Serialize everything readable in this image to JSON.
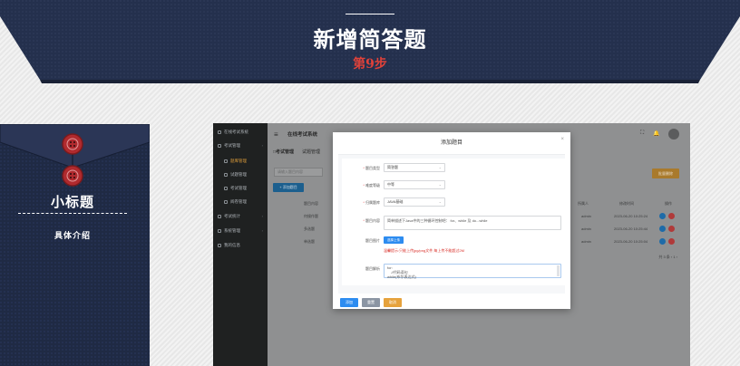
{
  "banner": {
    "title": "新增简答题",
    "step": "第9步",
    "background_color": "#232c47",
    "step_color": "#e0423a"
  },
  "envelope": {
    "title": "小标题",
    "subtitle": "具体介绍",
    "background_color": "#1f2a44",
    "button_color": "#b02a2e",
    "icons": [
      "button-icon",
      "button-icon"
    ]
  },
  "app": {
    "name": "在线考试系统",
    "sidebar": {
      "brand": "在线考试系统",
      "items": [
        {
          "label": "考试管理",
          "icon": "grid-icon",
          "chevron": "›"
        },
        {
          "label": "题库管理",
          "icon": "grid-icon"
        },
        {
          "label": "试题管理",
          "icon": "grid-icon"
        },
        {
          "label": "考试管理",
          "icon": "grid-icon"
        },
        {
          "label": "阅卷管理",
          "icon": "grid-icon"
        },
        {
          "label": "考试统计",
          "icon": "grid-icon",
          "chevron": "›"
        },
        {
          "label": "系统管理",
          "icon": "grid-icon",
          "chevron": "›"
        },
        {
          "label": "我的信息",
          "icon": "grid-icon"
        }
      ]
    },
    "header": {
      "menu_icon": "≡",
      "fullscreen_icon": "⛶",
      "bell_icon": "🔔"
    },
    "tabs": [
      "□考试管理",
      "试题管理"
    ],
    "search_placeholder": "请输入题目内容",
    "add_button": "+ 添加题目",
    "export_button": "批量删除",
    "table": {
      "headers": [
        "题目内容",
        "",
        "",
        "",
        "",
        "",
        "",
        "",
        "",
        "所属人",
        "修改时间",
        "操作"
      ],
      "rows": [
        {
          "content": "何操作题",
          "owner": "admin",
          "time": "2023-06-20 10:25:24"
        },
        {
          "content": "多选题",
          "owner": "admin",
          "time": "2023-06-20 10:25:44"
        },
        {
          "content": "单选题",
          "owner": "admin",
          "time": "2023-06-20 10:25:04"
        }
      ]
    },
    "pager": "共 3 条  ‹  1  ›"
  },
  "modal": {
    "title": "添加题目",
    "close": "×",
    "fields": {
      "type_label": "题目类型",
      "type_value": "简答题",
      "difficulty_label": "难度等级",
      "difficulty_value": "中等",
      "bank_label": "归属题库",
      "bank_value": "JAVA基础",
      "content_label": "题目内容",
      "content_value": "简单描述下Java中的三种循环控制吧： for、while 及 do...while",
      "image_label": "题目图片",
      "upload_label": "选择上传",
      "hint": "温馨提示:只能上传jpg/png文件,每上传不能超过2M",
      "analysis_label": "题目解析",
      "analysis_value": "for:\n    //代码语句\nwhile(布尔表达式)"
    },
    "buttons": {
      "submit": "添加",
      "reset": "重置",
      "cancel": "取消"
    },
    "colors": {
      "submit": "#2d8cf0",
      "reset": "#8b95a3",
      "cancel": "#e6a23c"
    }
  }
}
